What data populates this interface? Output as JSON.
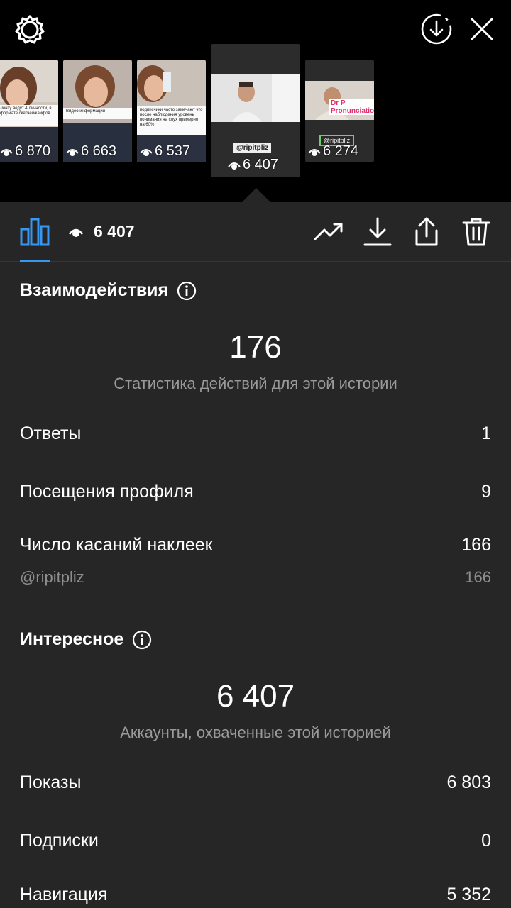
{
  "thumbnails": [
    {
      "views": "6 870",
      "caption": "Ленту ведут 4 личности, в формате скетчей/кайфов"
    },
    {
      "views": "6 663",
      "caption": "Видео информация"
    },
    {
      "views": "6 537",
      "caption": "подписчики часто замечают что после наблюдения уровень понимания на слух примерно на 60%"
    },
    {
      "views": "6 407",
      "handle": "@ripitpliz"
    },
    {
      "views": "6 274",
      "handle": "@ripitpliz",
      "overlay": "Dr P Pronunciation"
    }
  ],
  "toolbar": {
    "views": "6 407"
  },
  "interactions": {
    "title": "Взаимодействия",
    "total": "176",
    "subtitle": "Статистика действий для этой истории",
    "rows": [
      {
        "label": "Ответы",
        "value": "1"
      },
      {
        "label": "Посещения профиля",
        "value": "9"
      },
      {
        "label": "Число касаний наклеек",
        "value": "166"
      }
    ],
    "sub_row": {
      "label": "@ripitpliz",
      "value": "166"
    }
  },
  "discovery": {
    "title": "Интересное",
    "total": "6 407",
    "subtitle": "Аккаунты, охваченные этой историей",
    "rows": [
      {
        "label": "Показы",
        "value": "6 803"
      },
      {
        "label": "Подписки",
        "value": "0"
      },
      {
        "label": "Навигация",
        "value": "5 352"
      }
    ]
  },
  "colors": {
    "accent": "#3897f0",
    "panel": "#262626",
    "muted": "#9a9a9a"
  }
}
